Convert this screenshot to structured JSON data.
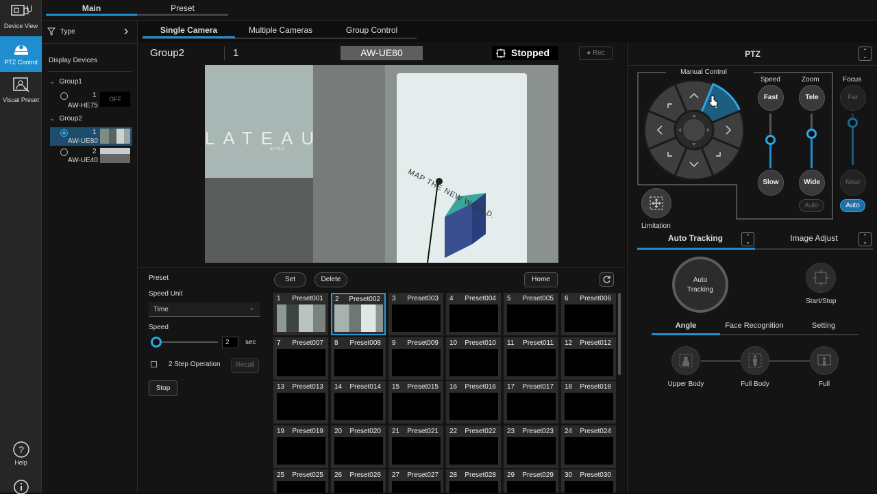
{
  "nav": {
    "device_view": "Device View",
    "ptz_control": "PTZ Control",
    "visual_preset": "Visual Preset",
    "help": "Help"
  },
  "top_tabs": {
    "main": "Main",
    "preset": "Preset"
  },
  "sidebar": {
    "type_label": "Type",
    "display_devices": "Display Devices",
    "group1": {
      "name": "Group1",
      "devices": [
        {
          "num": "1",
          "name": "AW-HE75",
          "status": "OFF"
        }
      ]
    },
    "group2": {
      "name": "Group2",
      "devices": [
        {
          "num": "1",
          "name": "AW-UE80"
        },
        {
          "num": "2",
          "name": "AW-UE40"
        }
      ]
    }
  },
  "sub_tabs": {
    "single": "Single Camera",
    "multiple": "Multiple Cameras",
    "group": "Group Control"
  },
  "camera_header": {
    "group": "Group2",
    "number": "1",
    "model": "AW-UE80",
    "status": "Stopped",
    "rec": "Rec"
  },
  "preview": {
    "banner_text": "MAP THE NEW WORLD.",
    "wall_text": "LATEAU",
    "wall_sub": "by MLIT"
  },
  "preset_panel": {
    "title": "Preset",
    "speed_unit_label": "Speed Unit",
    "speed_unit_value": "Time",
    "speed_label": "Speed",
    "speed_value": "2",
    "speed_unit": "sec",
    "two_step": "2 Step Operation",
    "recall": "Recall",
    "stop": "Stop",
    "set": "Set",
    "delete": "Delete",
    "home": "Home"
  },
  "presets": [
    {
      "num": "1",
      "label": "Preset001"
    },
    {
      "num": "2",
      "label": "Preset002"
    },
    {
      "num": "3",
      "label": "Preset003"
    },
    {
      "num": "4",
      "label": "Preset004"
    },
    {
      "num": "5",
      "label": "Preset005"
    },
    {
      "num": "6",
      "label": "Preset006"
    },
    {
      "num": "7",
      "label": "Preset007"
    },
    {
      "num": "8",
      "label": "Preset008"
    },
    {
      "num": "9",
      "label": "Preset009"
    },
    {
      "num": "10",
      "label": "Preset010"
    },
    {
      "num": "11",
      "label": "Preset011"
    },
    {
      "num": "12",
      "label": "Preset012"
    },
    {
      "num": "13",
      "label": "Preset013"
    },
    {
      "num": "14",
      "label": "Preset014"
    },
    {
      "num": "15",
      "label": "Preset015"
    },
    {
      "num": "16",
      "label": "Preset016"
    },
    {
      "num": "17",
      "label": "Preset017"
    },
    {
      "num": "18",
      "label": "Preset018"
    },
    {
      "num": "19",
      "label": "Preset019"
    },
    {
      "num": "20",
      "label": "Preset020"
    },
    {
      "num": "21",
      "label": "Preset021"
    },
    {
      "num": "22",
      "label": "Preset022"
    },
    {
      "num": "23",
      "label": "Preset023"
    },
    {
      "num": "24",
      "label": "Preset024"
    },
    {
      "num": "25",
      "label": "Preset025"
    },
    {
      "num": "26",
      "label": "Preset026"
    },
    {
      "num": "27",
      "label": "Preset027"
    },
    {
      "num": "28",
      "label": "Preset028"
    },
    {
      "num": "29",
      "label": "Preset029"
    },
    {
      "num": "30",
      "label": "Preset030"
    }
  ],
  "ptz": {
    "title": "PTZ",
    "manual_control": "Manual Control",
    "speed": "Speed",
    "zoom": "Zoom",
    "focus": "Focus",
    "fast": "Fast",
    "slow": "Slow",
    "tele": "Tele",
    "wide": "Wide",
    "far": "Far",
    "near": "Near",
    "zoom_auto": "Auto",
    "focus_auto": "Auto",
    "limitation": "Limitation"
  },
  "tracking": {
    "auto_tracking_tab": "Auto Tracking",
    "image_adjust_tab": "Image Adjust",
    "auto_tracking_btn_line1": "Auto",
    "auto_tracking_btn_line2": "Tracking",
    "start_stop": "Start/Stop",
    "angle_tab": "Angle",
    "face_tab": "Face Recognition",
    "setting_tab": "Setting",
    "upper_body": "Upper Body",
    "full_body": "Full Body",
    "full": "Full"
  },
  "colors": {
    "accent": "#1f8ecf",
    "selected": "#2aa8e8"
  }
}
